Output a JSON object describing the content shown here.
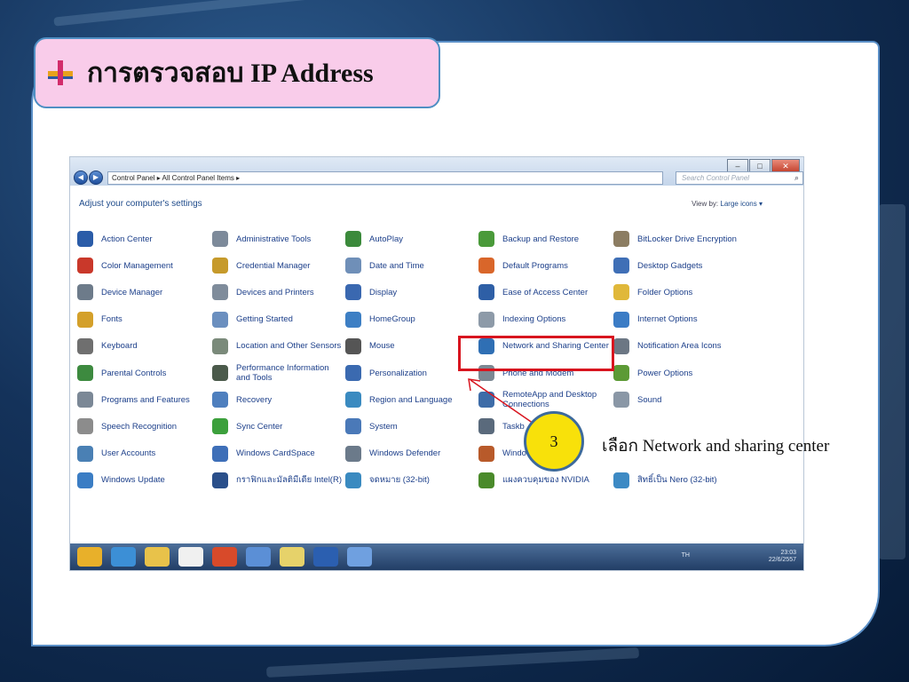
{
  "slide": {
    "title": "การตรวจสอบ IP Address",
    "step_number": "3",
    "step_text": "เลือก Network and sharing center"
  },
  "window": {
    "address": "Control Panel  ▸  All Control Panel Items  ▸",
    "search_placeholder": "Search Control Panel",
    "heading": "Adjust your computer's settings",
    "view_by_label": "View by:",
    "view_by_value": "Large icons ▾",
    "minimize": "–",
    "maximize": "□",
    "close": "✕"
  },
  "items": [
    {
      "label": "Action Center",
      "color": "#2a5ca8"
    },
    {
      "label": "Administrative Tools",
      "color": "#7d8a9a"
    },
    {
      "label": "AutoPlay",
      "color": "#3b8a3b"
    },
    {
      "label": "Backup and Restore",
      "color": "#4a9a3a"
    },
    {
      "label": "BitLocker Drive Encryption",
      "color": "#8c7d62"
    },
    {
      "label": "Color Management",
      "color": "#c9382a"
    },
    {
      "label": "Credential Manager",
      "color": "#c69a2b"
    },
    {
      "label": "Date and Time",
      "color": "#6f8fb8"
    },
    {
      "label": "Default Programs",
      "color": "#d9662a"
    },
    {
      "label": "Desktop Gadgets",
      "color": "#3f6fb6"
    },
    {
      "label": "Device Manager",
      "color": "#6d7b8a"
    },
    {
      "label": "Devices and Printers",
      "color": "#7f8c9b"
    },
    {
      "label": "Display",
      "color": "#3a68b0"
    },
    {
      "label": "Ease of Access Center",
      "color": "#2e5fa6"
    },
    {
      "label": "Folder Options",
      "color": "#e0b83a"
    },
    {
      "label": "Fonts",
      "color": "#d4a02a"
    },
    {
      "label": "Getting Started",
      "color": "#6b8fbf"
    },
    {
      "label": "HomeGroup",
      "color": "#3d7fc4"
    },
    {
      "label": "Indexing Options",
      "color": "#8d9aa8"
    },
    {
      "label": "Internet Options",
      "color": "#3b7cc5"
    },
    {
      "label": "Keyboard",
      "color": "#6f6f6f"
    },
    {
      "label": "Location and Other Sensors",
      "color": "#7a8a7a"
    },
    {
      "label": "Mouse",
      "color": "#555555"
    },
    {
      "label": "Network and Sharing Center",
      "color": "#2f6fb4"
    },
    {
      "label": "Notification Area Icons",
      "color": "#6c7784"
    },
    {
      "label": "Parental Controls",
      "color": "#3d8a3f"
    },
    {
      "label": "Performance Information and Tools",
      "color": "#4b5a4b"
    },
    {
      "label": "Personalization",
      "color": "#3b6ab0"
    },
    {
      "label": "Phone and Modem",
      "color": "#7c8893"
    },
    {
      "label": "Power Options",
      "color": "#5c9a35"
    },
    {
      "label": "Programs and Features",
      "color": "#7b8896"
    },
    {
      "label": "Recovery",
      "color": "#4e7fbe"
    },
    {
      "label": "Region and Language",
      "color": "#3a8ac0"
    },
    {
      "label": "RemoteApp and Desktop Connections",
      "color": "#3e6ca8"
    },
    {
      "label": "Sound",
      "color": "#8a97a6"
    },
    {
      "label": "Speech Recognition",
      "color": "#8c8c8c"
    },
    {
      "label": "Sync Center",
      "color": "#3ca03c"
    },
    {
      "label": "System",
      "color": "#4a79b8"
    },
    {
      "label": "Taskb",
      "color": "#5a6a7c"
    },
    {
      "label": "",
      "color": "#ffffff"
    },
    {
      "label": "User Accounts",
      "color": "#4a80b4"
    },
    {
      "label": "Windows CardSpace",
      "color": "#3e6fb8"
    },
    {
      "label": "Windows Defender",
      "color": "#6b7a8a"
    },
    {
      "label": "Window",
      "color": "#b85a2a"
    },
    {
      "label": "",
      "color": "#ffffff"
    },
    {
      "label": "Windows Update",
      "color": "#3b7dc4"
    },
    {
      "label": "กราฟิกและมัลติมีเดีย Intel(R)",
      "color": "#2a4f8a"
    },
    {
      "label": "จดหมาย (32-bit)",
      "color": "#3a8ac0"
    },
    {
      "label": "แผงควบคุมของ NVIDIA",
      "color": "#4a8a2a"
    },
    {
      "label": "สิทธิ์เป็น Nero (32-bit)",
      "color": "#3d8ac4"
    }
  ],
  "taskbar": {
    "lang": "TH",
    "time": "23:03",
    "date": "22/6/2557",
    "icons": [
      "#e8b02a",
      "#3c8fd6",
      "#e8c24a",
      "#f0f0f0",
      "#d84a2a",
      "#5b8fd6",
      "#e6d26a",
      "#2b5fb0",
      "#6fa0e0"
    ]
  }
}
